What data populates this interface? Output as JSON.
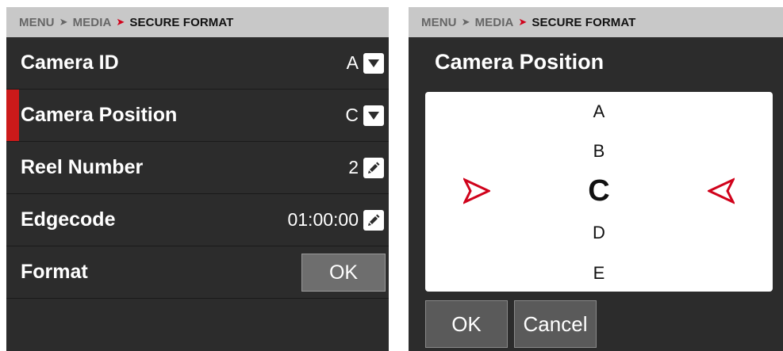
{
  "left": {
    "breadcrumb": {
      "menu": "MENU",
      "media": "MEDIA",
      "current": "SECURE FORMAT"
    },
    "rows": [
      {
        "label": "Camera ID",
        "value": "A",
        "control": "dropdown"
      },
      {
        "label": "Camera Position",
        "value": "C",
        "control": "dropdown",
        "selected": true
      },
      {
        "label": "Reel Number",
        "value": "2",
        "control": "edit"
      },
      {
        "label": "Edgecode",
        "value": "01:00:00",
        "control": "edit"
      },
      {
        "label": "Format",
        "button": "OK"
      }
    ]
  },
  "right": {
    "breadcrumb": {
      "menu": "MENU",
      "media": "MEDIA",
      "current": "SECURE FORMAT"
    },
    "dialog": {
      "title": "Camera Position",
      "options": [
        "A",
        "B",
        "C",
        "D",
        "E"
      ],
      "selected": "C",
      "ok": "OK",
      "cancel": "Cancel"
    }
  },
  "colors": {
    "accent": "#d0021b",
    "panel": "#2c2c2c",
    "header": "#c8c8c8"
  }
}
